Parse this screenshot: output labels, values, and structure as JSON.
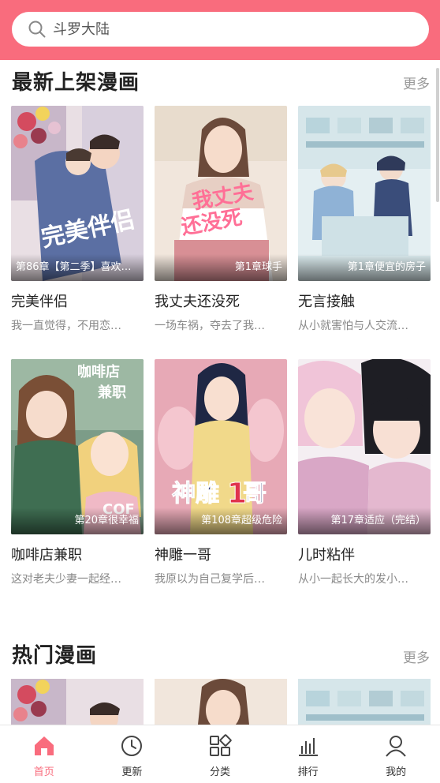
{
  "search": {
    "placeholder": "斗罗大陆"
  },
  "sections": {
    "new": {
      "title": "最新上架漫画",
      "more": "更多"
    },
    "hot": {
      "title": "热门漫画",
      "more": "更多"
    }
  },
  "new_comics": [
    {
      "title": "完美伴侣",
      "chapter": "第86章【第二季】喜欢…",
      "desc": "我一直觉得，不用恋…",
      "cover_text": "完美伴侣"
    },
    {
      "title": "我丈夫还没死",
      "chapter": "第1章球手",
      "desc": "一场车祸，夺去了我…",
      "cover_text": "我丈夫还没死"
    },
    {
      "title": "无言接触",
      "chapter": "第1章便宜的房子",
      "desc": "从小就害怕与人交流…"
    },
    {
      "title": "咖啡店兼职",
      "chapter": "第20章很幸福",
      "desc": "这对老夫少妻一起经…",
      "cover_text": "咖啡店兼职"
    },
    {
      "title": "神雕一哥",
      "chapter": "第108章超级危险",
      "desc": "我原以为自己复学后…",
      "cover_text": "神雕1哥"
    },
    {
      "title": "儿时粘伴",
      "chapter": "第17章适应（完结）",
      "desc": "从小一起长大的发小…"
    }
  ],
  "tabs": [
    {
      "label": "首页",
      "icon": "home-icon",
      "active": true
    },
    {
      "label": "更新",
      "icon": "clock-icon"
    },
    {
      "label": "分类",
      "icon": "category-icon"
    },
    {
      "label": "排行",
      "icon": "chart-icon"
    },
    {
      "label": "我的",
      "icon": "user-icon"
    }
  ],
  "colors": {
    "accent": "#f96c7d",
    "muted": "#999999"
  }
}
